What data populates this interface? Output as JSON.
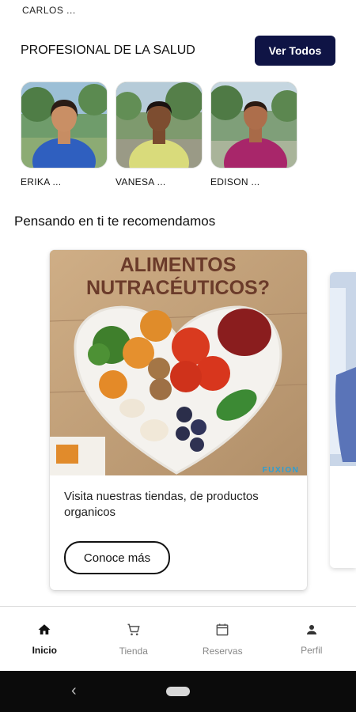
{
  "header": {
    "user_name": "CARLOS ..."
  },
  "professionals": {
    "title": "PROFESIONAL DE LA SALUD",
    "view_all_label": "Ver Todos",
    "items": [
      {
        "name": "ERIKA ..."
      },
      {
        "name": "VANESA ..."
      },
      {
        "name": "EDISON ..."
      }
    ]
  },
  "recommendations": {
    "title": "Pensando en ti te recomendamos",
    "cards": [
      {
        "image_heading_line1": "ALIMENTOS",
        "image_heading_line2": "NUTRACÉUTICOS?",
        "brand": "FUXION",
        "text": "Visita nuestras tiendas, de productos organicos",
        "button_label": "Conoce más"
      }
    ]
  },
  "bottom_nav": {
    "items": [
      {
        "label": "Inicio",
        "icon": "home-icon",
        "active": true
      },
      {
        "label": "Tienda",
        "icon": "cart-icon",
        "active": false
      },
      {
        "label": "Reservas",
        "icon": "calendar-icon",
        "active": false
      },
      {
        "label": "Perfil",
        "icon": "person-icon",
        "active": false
      }
    ]
  }
}
